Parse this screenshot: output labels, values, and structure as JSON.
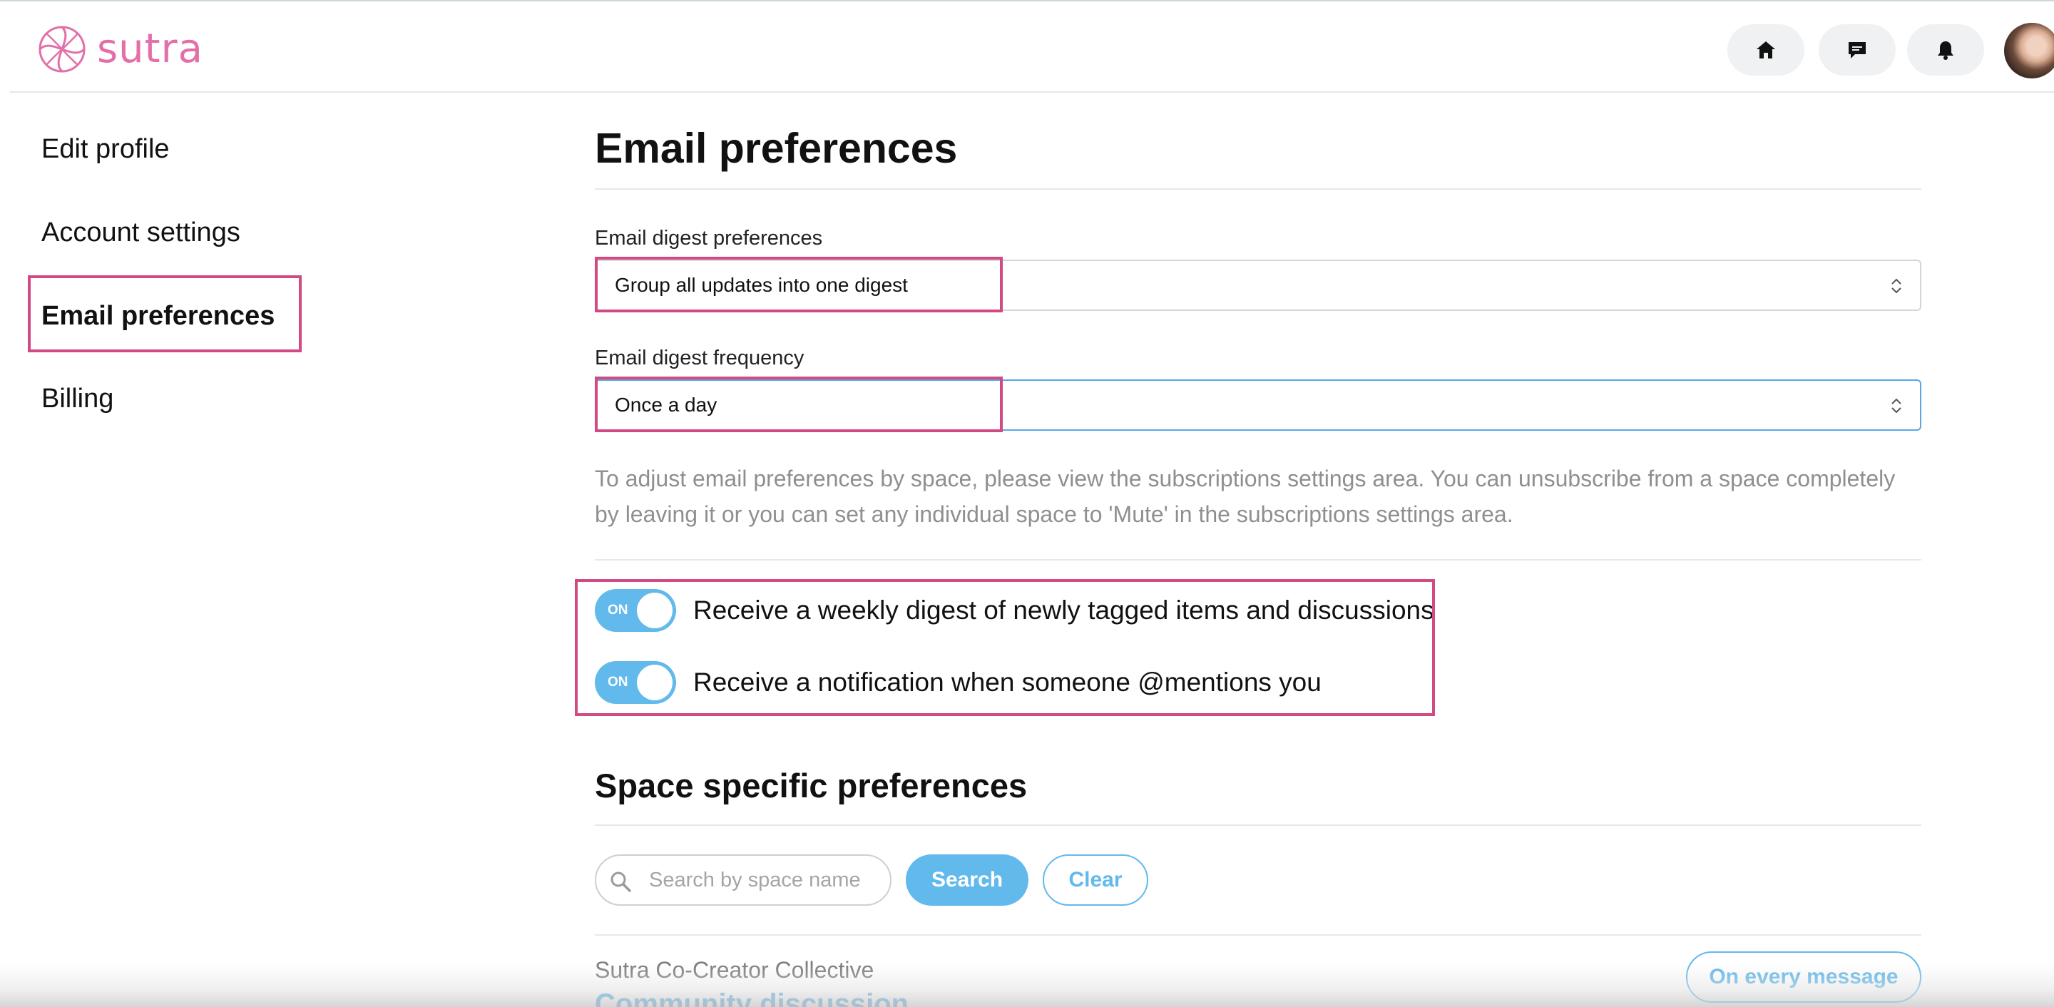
{
  "app": {
    "brand": "sutra",
    "brand_color": "#e36fa9",
    "accent_color": "#61b9ec",
    "highlight_color": "#d14a84"
  },
  "header": {
    "icons": [
      "home-icon",
      "chat-icon",
      "bell-icon"
    ]
  },
  "sidebar": {
    "items": [
      {
        "label": "Edit profile",
        "active": false
      },
      {
        "label": "Account settings",
        "active": false
      },
      {
        "label": "Email preferences",
        "active": true
      },
      {
        "label": "Billing",
        "active": false
      }
    ]
  },
  "main": {
    "title": "Email preferences",
    "digest_preferences": {
      "label": "Email digest preferences",
      "value": "Group all updates into one digest"
    },
    "digest_frequency": {
      "label": "Email digest frequency",
      "value": "Once a day"
    },
    "help_text": "To adjust email preferences by space, please view the subscriptions settings area. You can unsubscribe from a space completely by leaving it or you can set any individual space to 'Mute' in the subscriptions settings area.",
    "toggles": [
      {
        "state": "ON",
        "label": "Receive a weekly digest of newly tagged items and discussions"
      },
      {
        "state": "ON",
        "label": "Receive a notification when someone @mentions you"
      }
    ]
  },
  "space_preferences": {
    "title": "Space specific preferences",
    "search_placeholder": "Search by space name",
    "search_button": "Search",
    "clear_button": "Clear",
    "space_name": "Sutra Co-Creator Collective",
    "space_link": "Community discussion",
    "frequency_button": "On every message"
  }
}
